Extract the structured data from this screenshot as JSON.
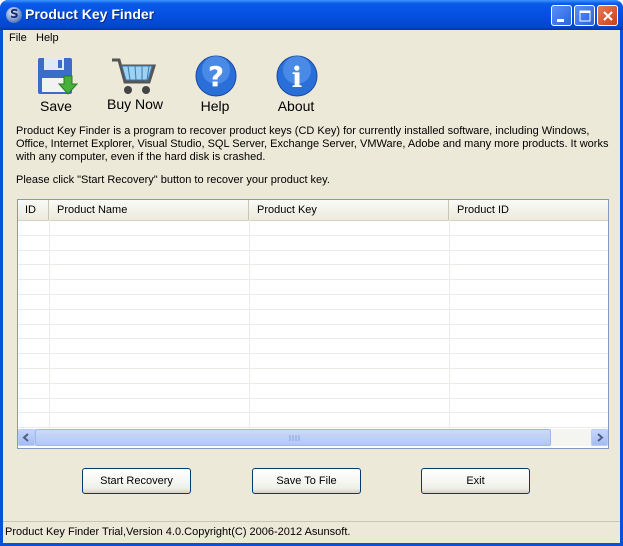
{
  "window": {
    "title": "Product Key Finder"
  },
  "menu": [
    "File",
    "Help"
  ],
  "toolbar": [
    {
      "label": "Save",
      "icon": "floppy-save-icon"
    },
    {
      "label": "Buy Now",
      "icon": "shopping-cart-icon"
    },
    {
      "label": "Help",
      "icon": "question-mark-icon"
    },
    {
      "label": "About",
      "icon": "info-icon"
    }
  ],
  "description": "Product Key Finder is a program to recover product keys (CD Key) for currently installed software, including Windows, Office, Internet Explorer, Visual Studio, SQL Server, Exchange Server, VMWare, Adobe and many more products. It works with any computer, even if the hard disk is crashed.",
  "hint": "Please click \"Start Recovery\" button to recover your product key.",
  "table": {
    "columns": [
      "ID",
      "Product Name",
      "Product Key",
      "Product ID"
    ],
    "rows": []
  },
  "buttons": {
    "start": "Start Recovery",
    "save": "Save To File",
    "exit": "Exit"
  },
  "status": "Product Key Finder Trial,Version 4.0.Copyright(C) 2006-2012 Asunsoft.",
  "colors": {
    "titlebar": "#0550e0",
    "background": "#ece9d8",
    "accent": "#316ac5"
  }
}
